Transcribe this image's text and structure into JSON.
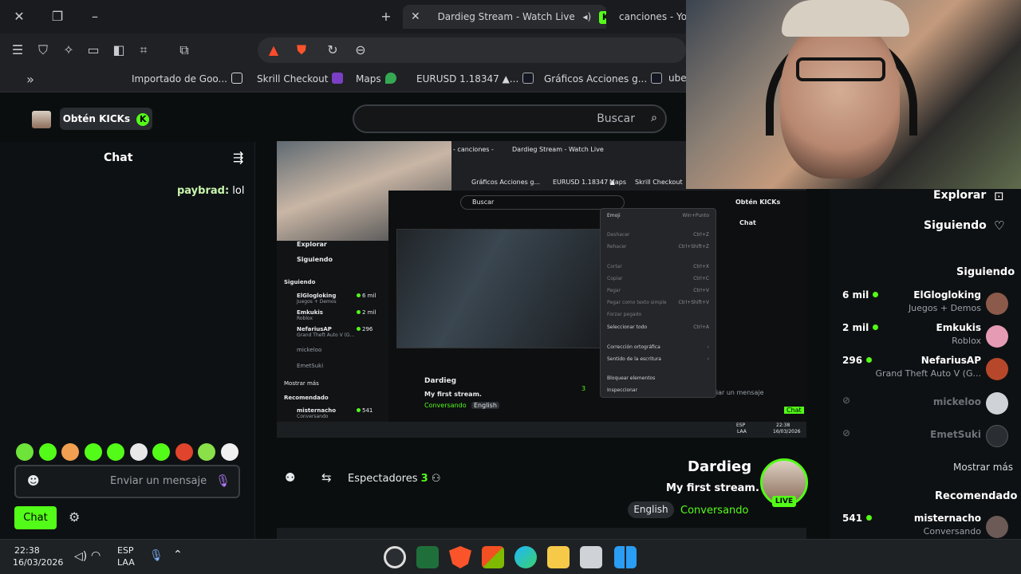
{
  "browser": {
    "tabs": [
      {
        "title": "Dardieg Stream - Watch Live",
        "active": true
      },
      {
        "title": "canciones - Yo",
        "active": false
      }
    ],
    "bookmarks": [
      {
        "label": "Importado de Goo...",
        "color": "#d5d7db"
      },
      {
        "label": "Skrill Checkout",
        "color": "#7a3fc4"
      },
      {
        "label": "Maps",
        "color": "#34a853"
      },
      {
        "label": "EURUSD 1.18347 ▲...",
        "color": "#131722"
      },
      {
        "label": "Gráficos Acciones g...",
        "color": "#131722"
      },
      {
        "label": "ube",
        "color": "#c9cbd0"
      }
    ],
    "icons": [
      "close-icon",
      "restore-icon",
      "minimize-icon",
      "new-tab-icon",
      "menu-icon",
      "shield-icon",
      "puzzle-icon",
      "wallet-icon",
      "sidebar-icon",
      "bookmark-icon",
      "screenshot-icon",
      "brave-icon",
      "reload-icon",
      "zoom-icon"
    ]
  },
  "kick": {
    "search_placeholder": "Buscar",
    "get_kicks": "Obtén KICKs",
    "chat": {
      "title": "Chat",
      "message_user": "paybrad:",
      "message_text": "lol",
      "input_placeholder": "Enviar un mensaje",
      "send_label": "Chat"
    },
    "channel": {
      "name": "Dardieg",
      "title": "My first stream.",
      "category": "Conversando",
      "language": "English",
      "live_badge": "LIVE",
      "viewers_count": "3",
      "viewers_label": "Espectadores"
    },
    "sidebar": {
      "explore": "Explorar",
      "following": "Siguiendo",
      "following_header": "Siguiendo",
      "channels": [
        {
          "name": "ElGlogloking",
          "category": "Juegos + Demos",
          "viewers": "6 mil",
          "live": true,
          "color": "#8b5a4a"
        },
        {
          "name": "Emkukis",
          "category": "Roblox",
          "viewers": "2 mil",
          "live": true,
          "color": "#e69bb4"
        },
        {
          "name": "NefariusAP",
          "category": "Grand Theft Auto V (G...",
          "viewers": "296",
          "live": true,
          "color": "#b7472a"
        },
        {
          "name": "mickeloo",
          "category": "",
          "viewers": "",
          "live": false,
          "color": "#cfd2d6"
        },
        {
          "name": "EmetSuki",
          "category": "",
          "viewers": "",
          "live": false,
          "color": "#2a2d31"
        }
      ],
      "show_more": "Mostrar más",
      "recommended_header": "Recomendado",
      "recommended": [
        {
          "name": "misternacho",
          "category": "Conversando",
          "viewers": "541",
          "live": true,
          "color": "#6b5a55"
        }
      ]
    }
  },
  "nested": {
    "tab": "Dardieg Stream - Watch Live",
    "tab2": "- canciones -",
    "bookmarks": [
      "Gráficos Acciones g...",
      "EURUSD 1.18347 ▲",
      "Skrill Checkout",
      "Maps"
    ],
    "search": "Buscar",
    "get_kicks": "Obtén KICKs",
    "chat": "Chat",
    "explore": "Explorar",
    "following": "Siguiendo",
    "following_header": "Siguiendo",
    "channels": [
      {
        "name": "ElGlogloking",
        "category": "Juegos + Demos",
        "viewers": "6 mil"
      },
      {
        "name": "Emkukis",
        "category": "Roblox",
        "viewers": "2 mil"
      },
      {
        "name": "NefariusAP",
        "category": "Grand Theft Auto V (G...",
        "viewers": "296"
      },
      {
        "name": "mickeloo",
        "category": "",
        "viewers": ""
      },
      {
        "name": "EmetSuki",
        "category": "",
        "viewers": ""
      }
    ],
    "show_more": "Mostrar más",
    "recommended_header": "Recomendado",
    "recommended": {
      "name": "misternacho",
      "category": "Conversando",
      "viewers": "541"
    },
    "channel_name": "Dardieg",
    "stream_title": "My first stream.",
    "category": "Conversando",
    "language": "English",
    "viewers": "3",
    "chat_placeholder": "Enviar un mensaje",
    "chat_send": "Chat",
    "context_menu": [
      {
        "label": "Emoji",
        "shortcut": "Win+Punto",
        "dim": false
      },
      {
        "label": "Deshacer",
        "shortcut": "Ctrl+Z",
        "dim": true
      },
      {
        "label": "Rehacer",
        "shortcut": "Ctrl+Shift+Z",
        "dim": true
      },
      {
        "label": "Cortar",
        "shortcut": "Ctrl+X",
        "dim": true
      },
      {
        "label": "Copiar",
        "shortcut": "Ctrl+C",
        "dim": true
      },
      {
        "label": "Pegar",
        "shortcut": "Ctrl+V",
        "dim": true
      },
      {
        "label": "Pegar como texto simple",
        "shortcut": "Ctrl+Shift+V",
        "dim": true
      },
      {
        "label": "Forzar pegado",
        "shortcut": "",
        "dim": true
      },
      {
        "label": "Seleccionar todo",
        "shortcut": "Ctrl+A",
        "dim": false
      },
      {
        "label": "Corrección ortográfica",
        "shortcut": "›",
        "dim": false
      },
      {
        "label": "Sentido de la escritura",
        "shortcut": "›",
        "dim": false
      },
      {
        "label": "Bloquear elementos",
        "shortcut": "",
        "dim": false
      },
      {
        "label": "Inspeccionar",
        "shortcut": "",
        "dim": false
      }
    ],
    "tray_lang": "ESP",
    "tray_lang2": "LAA",
    "tray_time": "22:38",
    "tray_date": "16/03/2026"
  },
  "taskbar": {
    "lang_top": "ESP",
    "lang_bottom": "LAA",
    "time": "22:38",
    "date": "16/03/2026",
    "apps": [
      "windows-start-icon",
      "file-explorer-icon",
      "folder-icon",
      "edge-icon",
      "store-icon",
      "brave-icon",
      "download-icon",
      "obs-icon"
    ]
  },
  "colors": {
    "accent": "#53fc18",
    "background": "#0b0e0f",
    "panel": "#0e1113"
  }
}
